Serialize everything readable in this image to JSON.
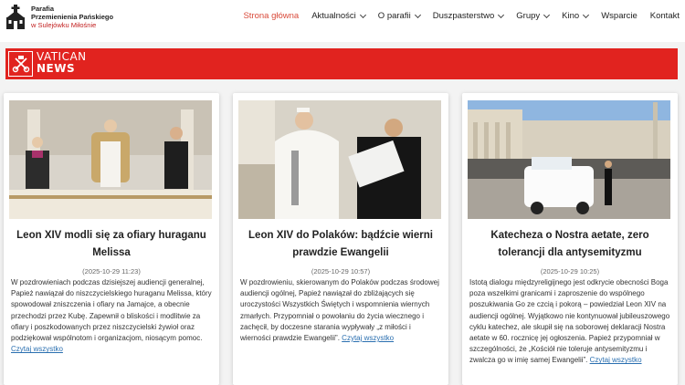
{
  "site": {
    "name_line1": "Parafia",
    "name_line2": "Przemienienia Pańskiego",
    "name_line3": "w Sulejówku Miłośnie"
  },
  "nav": {
    "items": [
      {
        "label": "Strona główna",
        "active": true,
        "dropdown": false
      },
      {
        "label": "Aktualności",
        "dropdown": true
      },
      {
        "label": "O parafii",
        "dropdown": true
      },
      {
        "label": "Duszpasterstwo",
        "dropdown": true
      },
      {
        "label": "Grupy",
        "dropdown": true
      },
      {
        "label": "Kino",
        "dropdown": true
      },
      {
        "label": "Wsparcie",
        "dropdown": false
      },
      {
        "label": "Kontakt",
        "dropdown": false
      }
    ]
  },
  "banner": {
    "line1": "VATICAN",
    "line2": "NEWS",
    "color": "#e1231f"
  },
  "articles": [
    {
      "title": "Leon XIV modli się za ofiary huraganu Melissa",
      "date": "(2025-10-29 11:23)",
      "body": "W pozdrowieniach podczas dzisiejszej audiencji generalnej, Papież nawiązał do niszczycielskiego huraganu Melissa, który spowodował zniszczenia i ofiary na Jamajce, a obecnie przechodzi przez Kubę. Zapewnił o bliskości i modlitwie za ofiary i poszkodowanych przez niszczycielski żywioł oraz podziękował wspólnotom i organizacjom, niosącym pomoc.",
      "more": "Czytaj wszystko"
    },
    {
      "title": "Leon XIV do Polaków: bądźcie wierni prawdzie Ewangelii",
      "date": "(2025-10-29 10:57)",
      "body": "W pozdrowieniu, skierowanym do Polaków podczas środowej audiencji ogólnej, Papież nawiązał do zbliżających się uroczystości Wszystkich Świętych i wspomnienia wiernych zmarłych. Przypomniał o powołaniu do życia wiecznego i zachęcił, by doczesne starania wypływały „z miłości i wierności prawdzie Ewangelii”.",
      "more": "Czytaj wszystko"
    },
    {
      "title": "Katecheza o Nostra aetate, zero tolerancji dla antysemityzmu",
      "date": "(2025-10-29 10:25)",
      "body": "Istotą dialogu międzyreligijnego jest odkrycie obecności Boga poza wszelkimi granicami i zaproszenie do wspólnego poszukiwania Go ze czcią i pokorą – powiedział Leon XIV na audiencji ogólnej. Wyjątkowo nie kontynuował jubileuszowego cyklu katechez, ale skupił się na soborowej deklaracji Nostra aetate w 60. rocznicę jej ogłoszenia. Papież przypomniał w szczególności, że „Kościół nie toleruje antysemityzmu i zwalcza go w imię samej Ewangelii”.",
      "more": "Czytaj wszystko"
    }
  ]
}
